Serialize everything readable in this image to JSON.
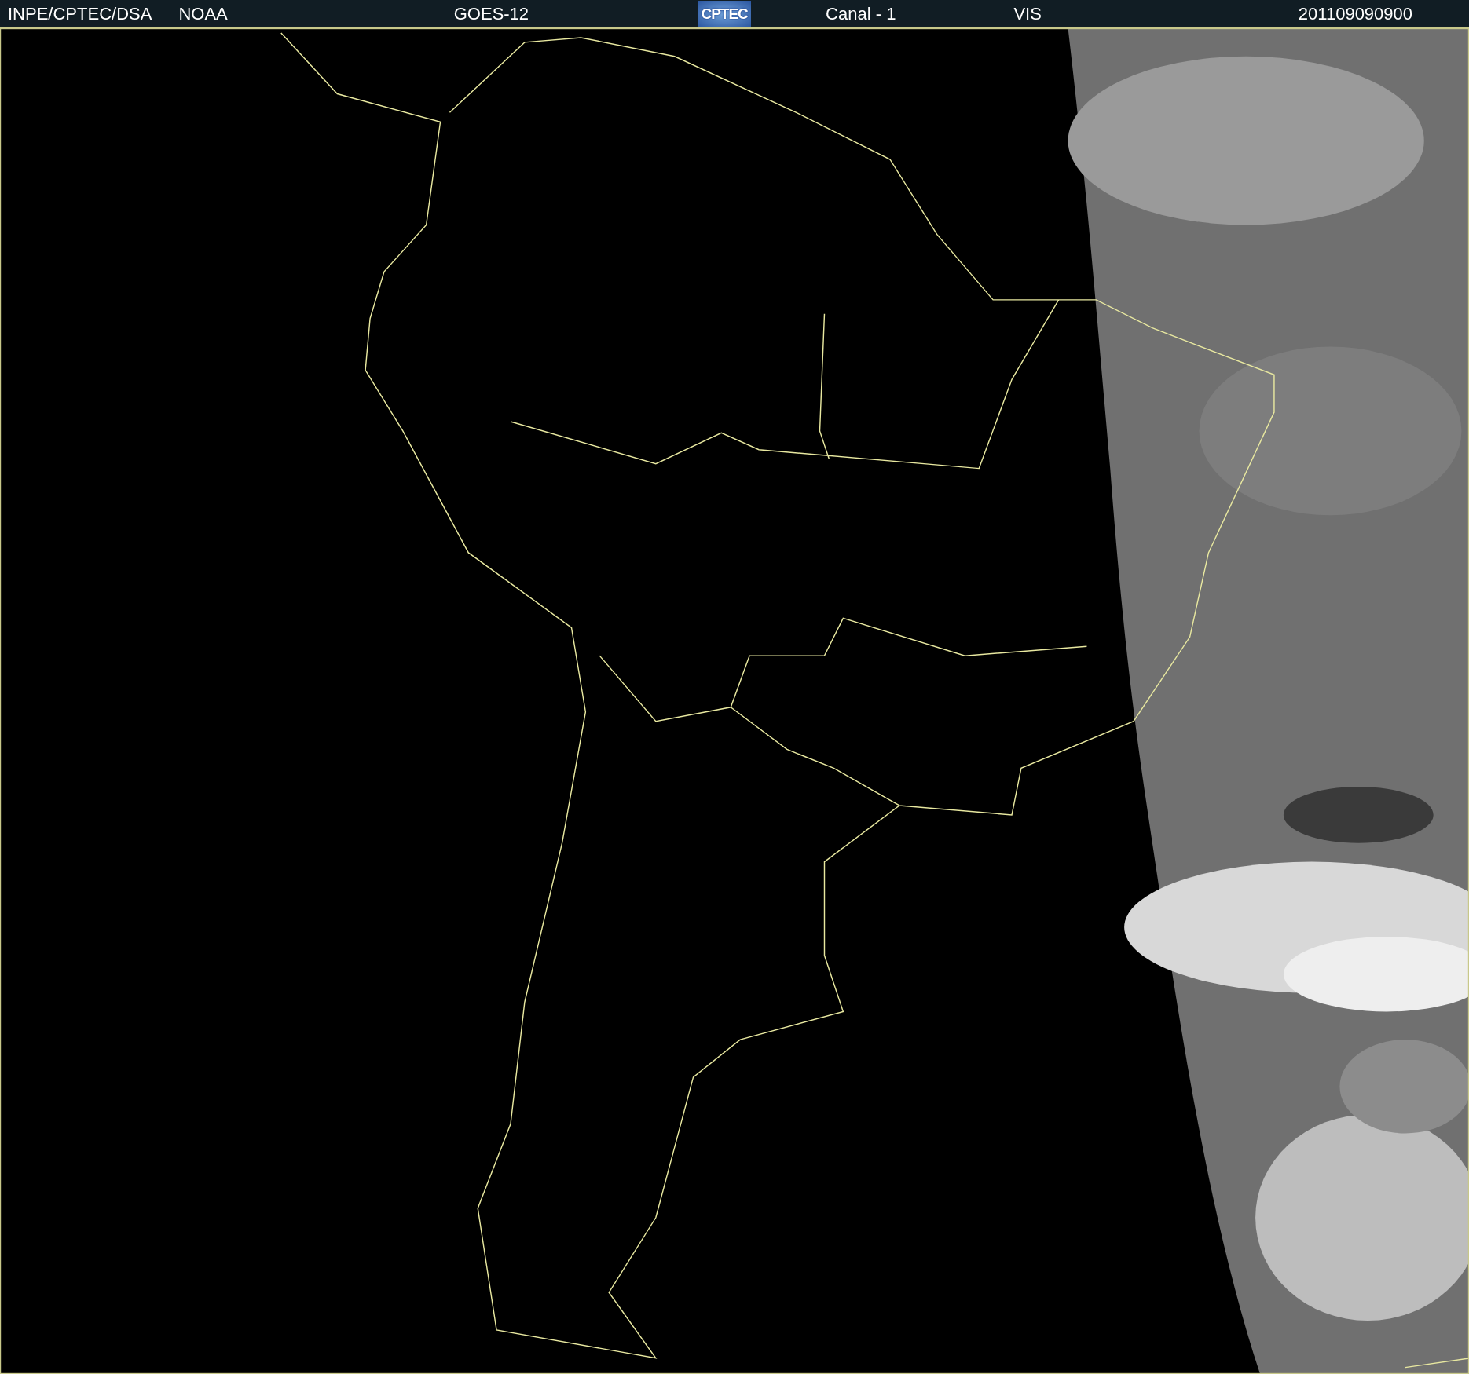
{
  "header": {
    "source": "INPE/CPTEC/DSA",
    "agency": "NOAA",
    "satellite": "GOES-12",
    "logo": "CPTEC",
    "channel": "Canal - 1",
    "band": "VIS",
    "timestamp": "201109090900"
  }
}
